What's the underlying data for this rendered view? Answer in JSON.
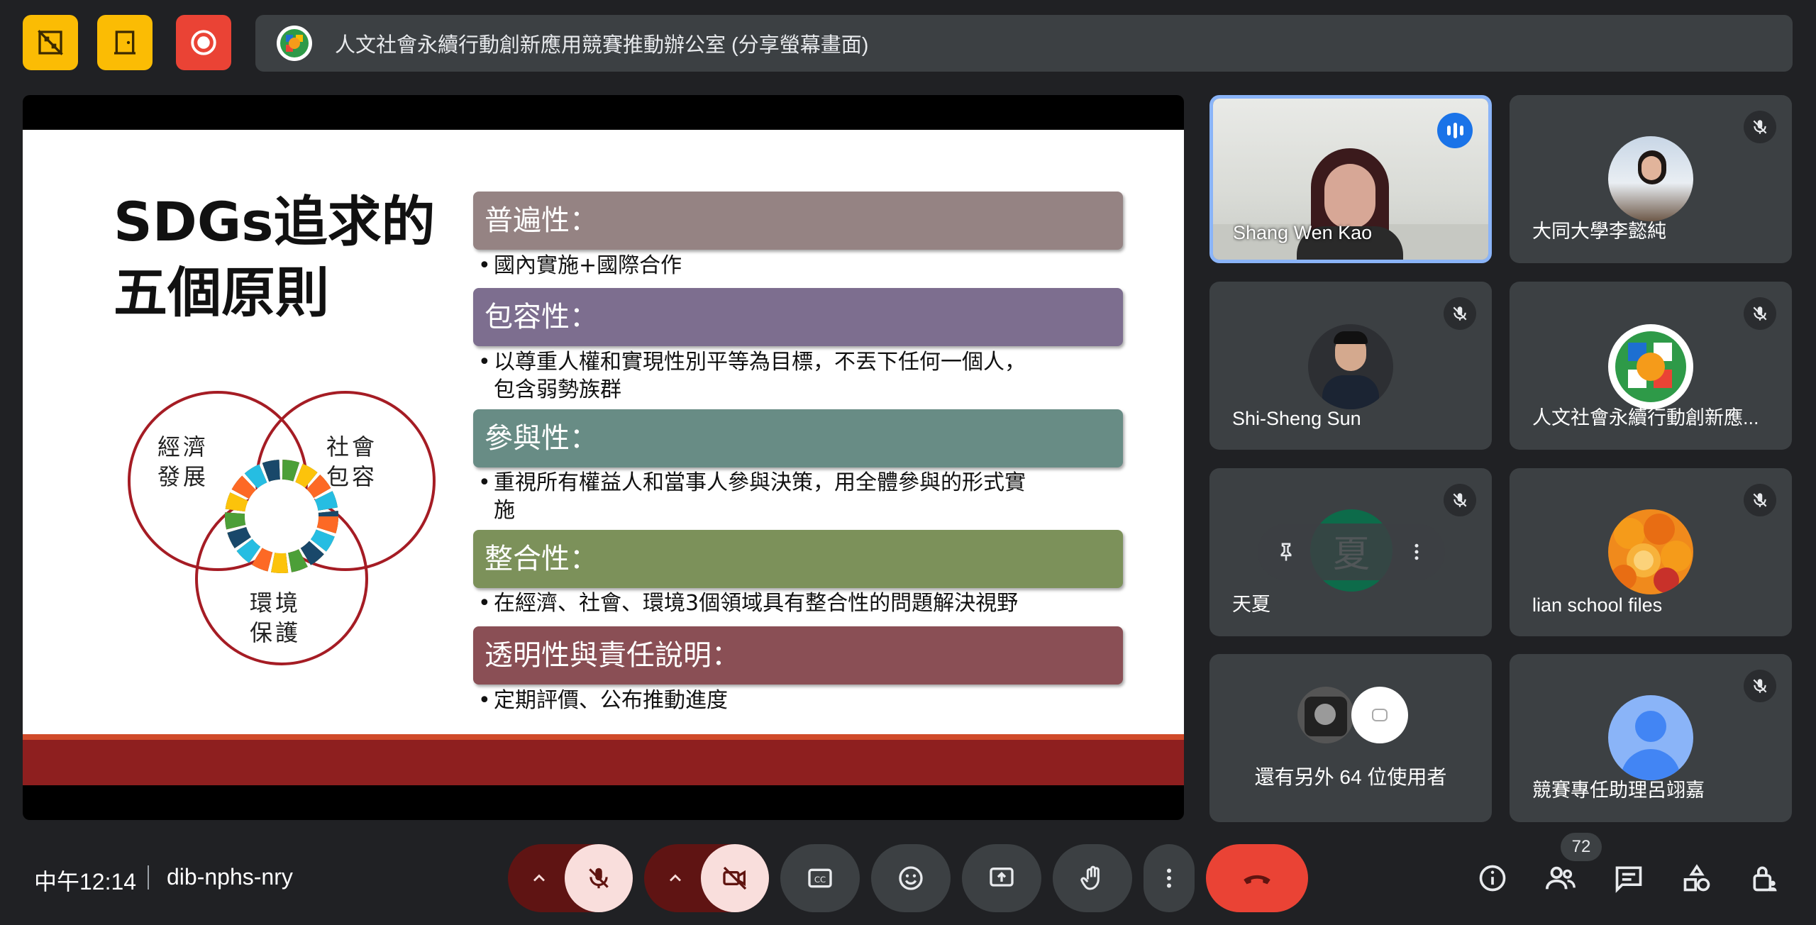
{
  "topbar": {
    "presenter_title": "人文社會永續行動創新應用競賽推動辦公室 (分享螢幕畫面)"
  },
  "slide": {
    "title_line1": "SDGs追求的",
    "title_line2": "五個原則",
    "venn": {
      "economy": [
        "經濟",
        "發展"
      ],
      "society": [
        "社會",
        "包容"
      ],
      "environment": [
        "環境",
        "保護"
      ]
    },
    "principles": [
      {
        "header": "普遍性：",
        "body": [
          "國內實施+國際合作"
        ],
        "color": "#958383"
      },
      {
        "header": "包容性：",
        "body": [
          "以尊重人權和實現性別平等為目標，不丟下任何一個人，",
          "包含弱勢族群"
        ],
        "color": "#7d6e8f"
      },
      {
        "header": "參與性：",
        "body": [
          "重視所有權益人和當事人參與決策，用全體參與的形式實",
          "施"
        ],
        "color": "#688c85"
      },
      {
        "header": "整合性：",
        "body": [
          "在經濟、社會、環境3個領域具有整合性的問題解決視野"
        ],
        "color": "#7c915a"
      },
      {
        "header": "透明性與責任說明：",
        "body": [
          "定期評價、公布推動進度"
        ],
        "color": "#8a4f55"
      }
    ]
  },
  "participants": [
    {
      "name": "Shang Wen Kao",
      "speaking": true
    },
    {
      "name": "大同大學李懿純",
      "muted": true
    },
    {
      "name": "Shi-Sheng Sun",
      "muted": true
    },
    {
      "name": "人文社會永續行動創新應...",
      "muted": true
    },
    {
      "name": "天夏",
      "initial": "夏",
      "muted": true
    },
    {
      "name": "lian school files",
      "muted": true
    },
    {
      "others_text": "還有另外 64 位使用者"
    },
    {
      "name": "競賽專任助理呂翊嘉",
      "muted": true
    }
  ],
  "bottombar": {
    "clock": "中午12:14",
    "meeting_code": "dib-nphs-nry",
    "participant_count": "72"
  },
  "colors": {
    "background": "#202124",
    "tile": "#3c4043",
    "accent_blue": "#8ab4f8",
    "danger_red": "#ea4335",
    "warning_yellow": "#fbbc04"
  }
}
